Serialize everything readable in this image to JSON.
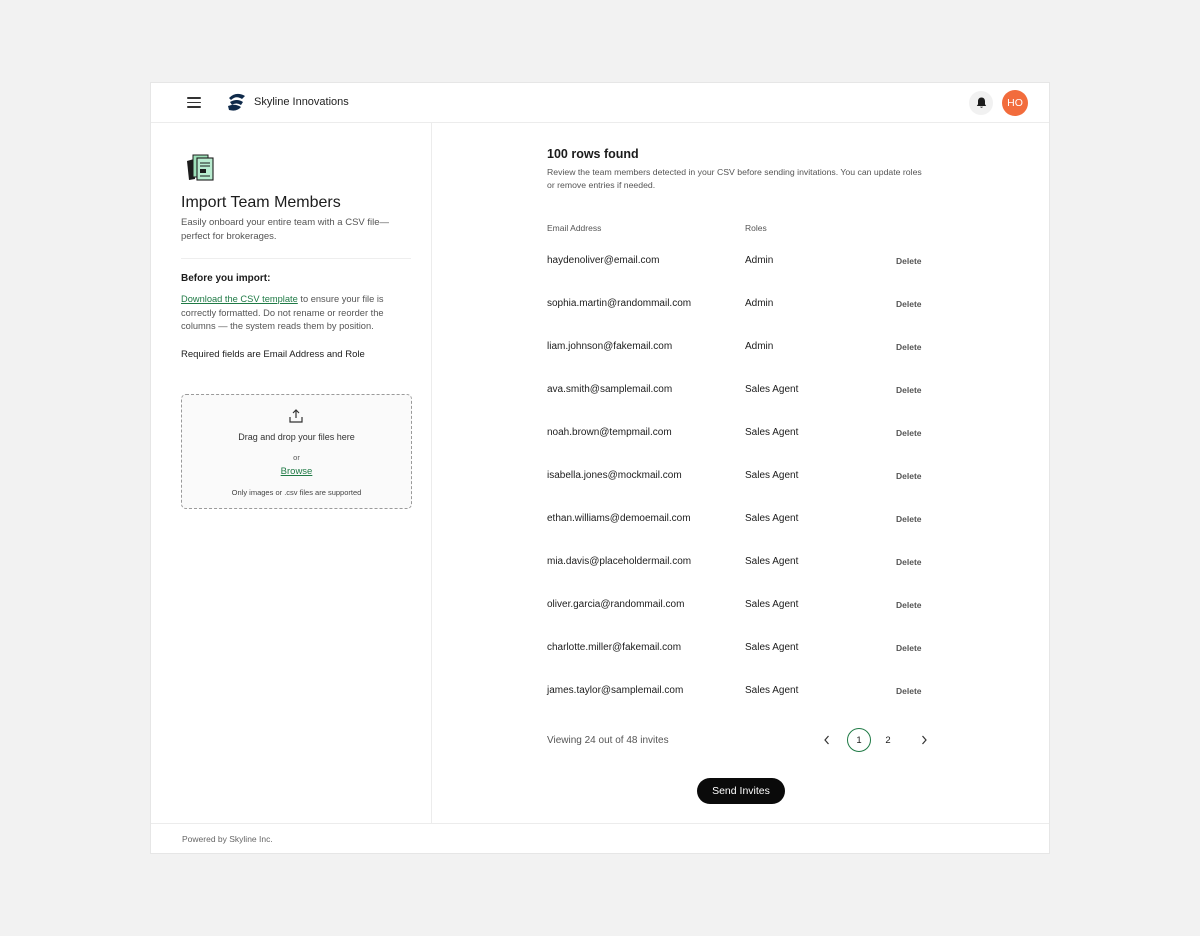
{
  "app": {
    "brand": "Skyline Innovations",
    "avatar_initials": "HO",
    "accent_color": "#1f7a45",
    "avatar_color": "#f26c3c"
  },
  "left": {
    "title": "Import Team Members",
    "subtitle": "Easily onboard your entire team with a CSV file—perfect for brokerages.",
    "before_title": "Before you import:",
    "template_link": "Download the CSV template",
    "template_text": " to ensure your file is correctly formatted. Do not rename or reorder the columns — the system reads them by position.",
    "required_text": "Required fields are Email Address and Role",
    "dropzone": {
      "main": "Drag and drop your files here",
      "or": "or",
      "browse": "Browse",
      "note": "Only images or .csv files are supported"
    }
  },
  "right": {
    "title": "100 rows found",
    "description": "Review the team members detected in your CSV before sending invitations. You can update roles or remove entries if needed.",
    "columns": {
      "email": "Email Address",
      "roles": "Roles"
    },
    "delete_label": "Delete",
    "rows": [
      {
        "email": "haydenoliver@email.com",
        "role": "Admin"
      },
      {
        "email": "sophia.martin@randommail.com",
        "role": "Admin"
      },
      {
        "email": "liam.johnson@fakemail.com",
        "role": "Admin"
      },
      {
        "email": "ava.smith@samplemail.com",
        "role": "Sales Agent"
      },
      {
        "email": "noah.brown@tempmail.com",
        "role": "Sales Agent"
      },
      {
        "email": "isabella.jones@mockmail.com",
        "role": "Sales Agent"
      },
      {
        "email": "ethan.williams@demoemail.com",
        "role": "Sales Agent"
      },
      {
        "email": "mia.davis@placeholdermail.com",
        "role": "Sales Agent"
      },
      {
        "email": "oliver.garcia@randommail.com",
        "role": "Sales Agent"
      },
      {
        "email": "charlotte.miller@fakemail.com",
        "role": "Sales Agent"
      },
      {
        "email": "james.taylor@samplemail.com",
        "role": "Sales Agent"
      }
    ],
    "viewing_text": "Viewing 24 out of 48 invites",
    "pagination": {
      "pages": [
        "1",
        "2"
      ],
      "current": "1"
    },
    "send_label": "Send Invites"
  },
  "footer": {
    "text": "Powered by Skyline Inc."
  }
}
